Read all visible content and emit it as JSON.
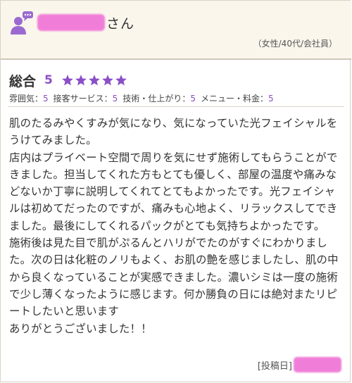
{
  "header": {
    "name_suffix": "さん",
    "profile": "（女性/40代/会社員）"
  },
  "rating": {
    "overall_label": "総合",
    "overall_score": "5",
    "stars": 5,
    "star_color": "#8a4fc7",
    "sub": [
      {
        "label": "雰囲気：",
        "score": "5"
      },
      {
        "label": "接客サービス：",
        "score": "5"
      },
      {
        "label": "技術・仕上がり：",
        "score": "5"
      },
      {
        "label": "メニュー・料金：",
        "score": "5"
      }
    ]
  },
  "review": {
    "paragraphs": [
      "肌のたるみやくすみが気になり、気になっていた光フェイシャルをうけてみました。",
      "店内はプライベート空間で周りを気にせず施術してもらうことができました。担当してくれた方もとても優しく、部屋の温度や痛みなどないか丁寧に説明してくれてとてもよかったです。光フェイシャルは初めてだったのですが、痛みも心地よく、リラックスしてできました。最後にしてくれるパックがとても気持ちよかったです。",
      "施術後は見た目で肌がぷるんとハリがでたのがすぐにわかりました。次の日は化粧のノリもよく、お肌の艶を感じましたし、肌の中から良くなっていることが実感できました。濃いシミは一度の施術で少し薄くなったように感じます。何か勝負の日には絶対またリピートしたいと思います",
      "ありがとうございました！！"
    ]
  },
  "footer": {
    "posted_label": "[投稿日]"
  },
  "colors": {
    "accent": "#8a4fc7",
    "redaction": "#f07ed8",
    "header_bg": "#fbf6ec"
  }
}
